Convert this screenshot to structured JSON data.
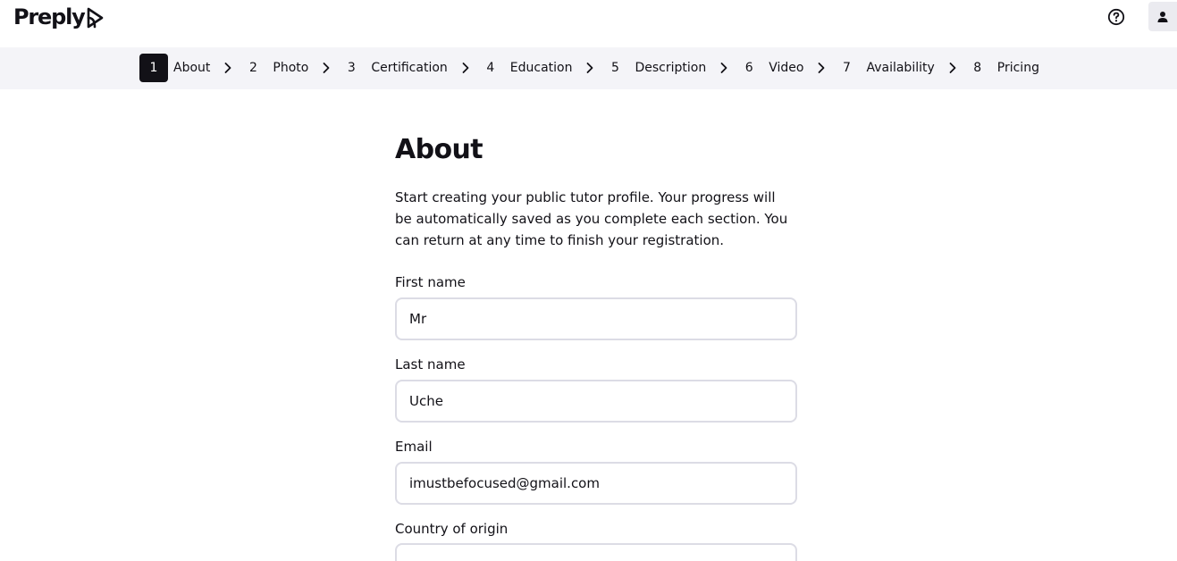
{
  "brand": {
    "logo_text": "Preply"
  },
  "header": {
    "help_icon": "help-circle-icon",
    "user_icon": "user-icon"
  },
  "steps": [
    {
      "num": "1",
      "label": "About",
      "active": true
    },
    {
      "num": "2",
      "label": "Photo",
      "active": false
    },
    {
      "num": "3",
      "label": "Certification",
      "active": false
    },
    {
      "num": "4",
      "label": "Education",
      "active": false
    },
    {
      "num": "5",
      "label": "Description",
      "active": false
    },
    {
      "num": "6",
      "label": "Video",
      "active": false
    },
    {
      "num": "7",
      "label": "Availability",
      "active": false
    },
    {
      "num": "8",
      "label": "Pricing",
      "active": false
    }
  ],
  "main": {
    "title": "About",
    "intro": "Start creating your public tutor profile. Your progress will be automatically saved as you complete each section. You can return at any time to finish your registration.",
    "fields": {
      "first_name": {
        "label": "First name",
        "value": "Mr"
      },
      "last_name": {
        "label": "Last name",
        "value": "Uche"
      },
      "email": {
        "label": "Email",
        "value": "imustbefocused@gmail.com"
      },
      "country": {
        "label": "Country of origin"
      }
    }
  },
  "colors": {
    "text": "#121117",
    "stepbar_bg": "#f4f4f8",
    "input_border": "#dcdce5",
    "active_step_bg": "#121117"
  }
}
